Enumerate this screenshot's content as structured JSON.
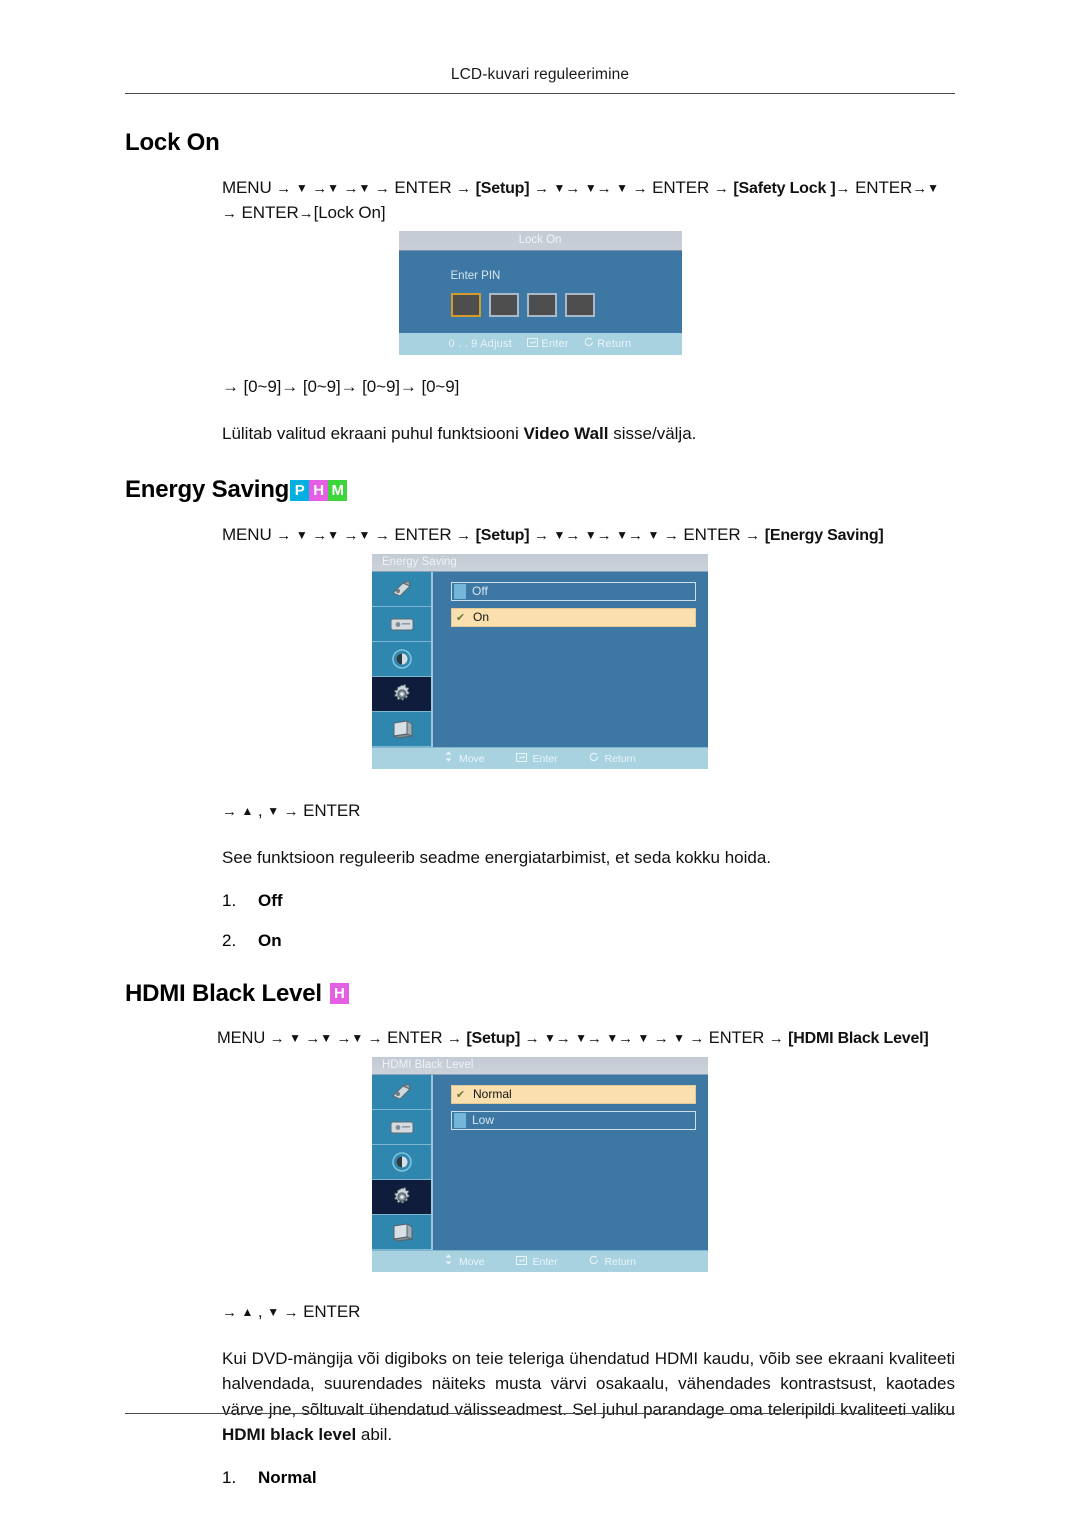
{
  "running_head": "LCD-kuvari reguleerimine",
  "sections": [
    {
      "id": "lock-on",
      "title": "Lock On",
      "badges": [],
      "path_line1": "MENU → ▼ →▼ →▼ → ENTER → [Setup] → ▼→ ▼→ ▼ → ENTER → [Safety Lock ]→ ENTER→▼",
      "path_line2": "→ ENTER→[Lock On]",
      "path_tokens": {
        "menu": "MENU",
        "enter": "ENTER",
        "setup": "Setup",
        "safety_lock": "Safety Lock ",
        "lock_on": "Lock On"
      },
      "digits_line": "→ [0~9]→ [0~9]→ [0~9]→ [0~9]",
      "description": "Lülitab valitud ekraani puhul funktsiooni Video Wall sisse/välja.",
      "description_bold": "Video Wall"
    },
    {
      "id": "energy-saving",
      "title": "Energy Saving",
      "badges": [
        {
          "letter": "P",
          "color": "#00b0e0"
        },
        {
          "letter": "H",
          "color": "#e55fe5"
        },
        {
          "letter": "M",
          "color": "#3cd63c"
        }
      ],
      "path_line1": "MENU → ▼ →▼ →▼ → ENTER → [Setup] → ▼→ ▼→ ▼→ ▼ → ENTER → [Energy Saving]",
      "nav_line": "→ ▲ , ▼ → ENTER",
      "description": "See funktsioon reguleerib seadme energiatarbimist, et seda kokku hoida.",
      "options": [
        {
          "num": "1.",
          "label": "Off"
        },
        {
          "num": "2.",
          "label": "On"
        }
      ]
    },
    {
      "id": "hdmi-black-level",
      "title": "HDMI Black Level",
      "badges": [
        {
          "letter": "H",
          "color": "#e55fe5"
        }
      ],
      "path_line1": "MENU → ▼ →▼ →▼ → ENTER → [Setup] → ▼→ ▼→ ▼→ ▼ → ▼ → ENTER → [HDMI Black Level]",
      "nav_line": "→ ▲ , ▼ → ENTER",
      "description": "Kui DVD-mängija või digiboks on teie teleriga ühendatud HDMI kaudu, võib see ekraani kvaliteeti halvendada, suurendades näiteks musta värvi osakaalu, vähendades kontrastsust, kaotades värve jne, sõltuvalt ühendatud välisseadmest. Sel juhul parandage oma teleripildi kvaliteeti valiku HDMI black level abil.",
      "description_parts": {
        "pre": "Kui DVD-mängija või digiboks on teie teleriga ühendatud HDMI kaudu, võib see ekraani kvaliteeti halvendada, suurendades näiteks musta värvi osakaalu, vähendades kontrastsust, kaotades värve jne, sõltuvalt ühendatud välisseadmest. Sel juhul parandage oma teleripildi kvaliteeti valiku ",
        "bold": "HDMI black level",
        "post": " abil."
      },
      "options": [
        {
          "num": "1.",
          "label": "Normal"
        }
      ]
    }
  ],
  "lock_on_dialog": {
    "title": "Lock On",
    "prompt": "Enter PIN",
    "pin_boxes": 4,
    "active_box_index": 0,
    "footer": {
      "adjust": "0 . . 9  Adjust",
      "enter": "Enter",
      "return": "Return"
    }
  },
  "energy_saving_osd": {
    "title": "Energy Saving",
    "sidebar_icons": [
      "picture-icon",
      "sound-icon",
      "contrast-icon",
      "setup-gear-icon",
      "multi-control-icon"
    ],
    "selected_sidebar_index": 3,
    "options": [
      {
        "label": "Off",
        "selected": false
      },
      {
        "label": "On",
        "selected": true
      }
    ],
    "footer": {
      "move": "Move",
      "enter": "Enter",
      "return": "Return"
    }
  },
  "hdmi_black_level_osd": {
    "title": "HDMI Black Level",
    "sidebar_icons": [
      "picture-icon",
      "sound-icon",
      "contrast-icon",
      "setup-gear-icon",
      "multi-control-icon"
    ],
    "selected_sidebar_index": 3,
    "options": [
      {
        "label": "Normal",
        "selected": true
      },
      {
        "label": "Low",
        "selected": false
      }
    ],
    "footer": {
      "move": "Move",
      "enter": "Enter",
      "return": "Return"
    }
  },
  "glyphs": {
    "check": "✔",
    "arrow_right": "→",
    "down_tri": "▼",
    "up_tri": "▲"
  }
}
